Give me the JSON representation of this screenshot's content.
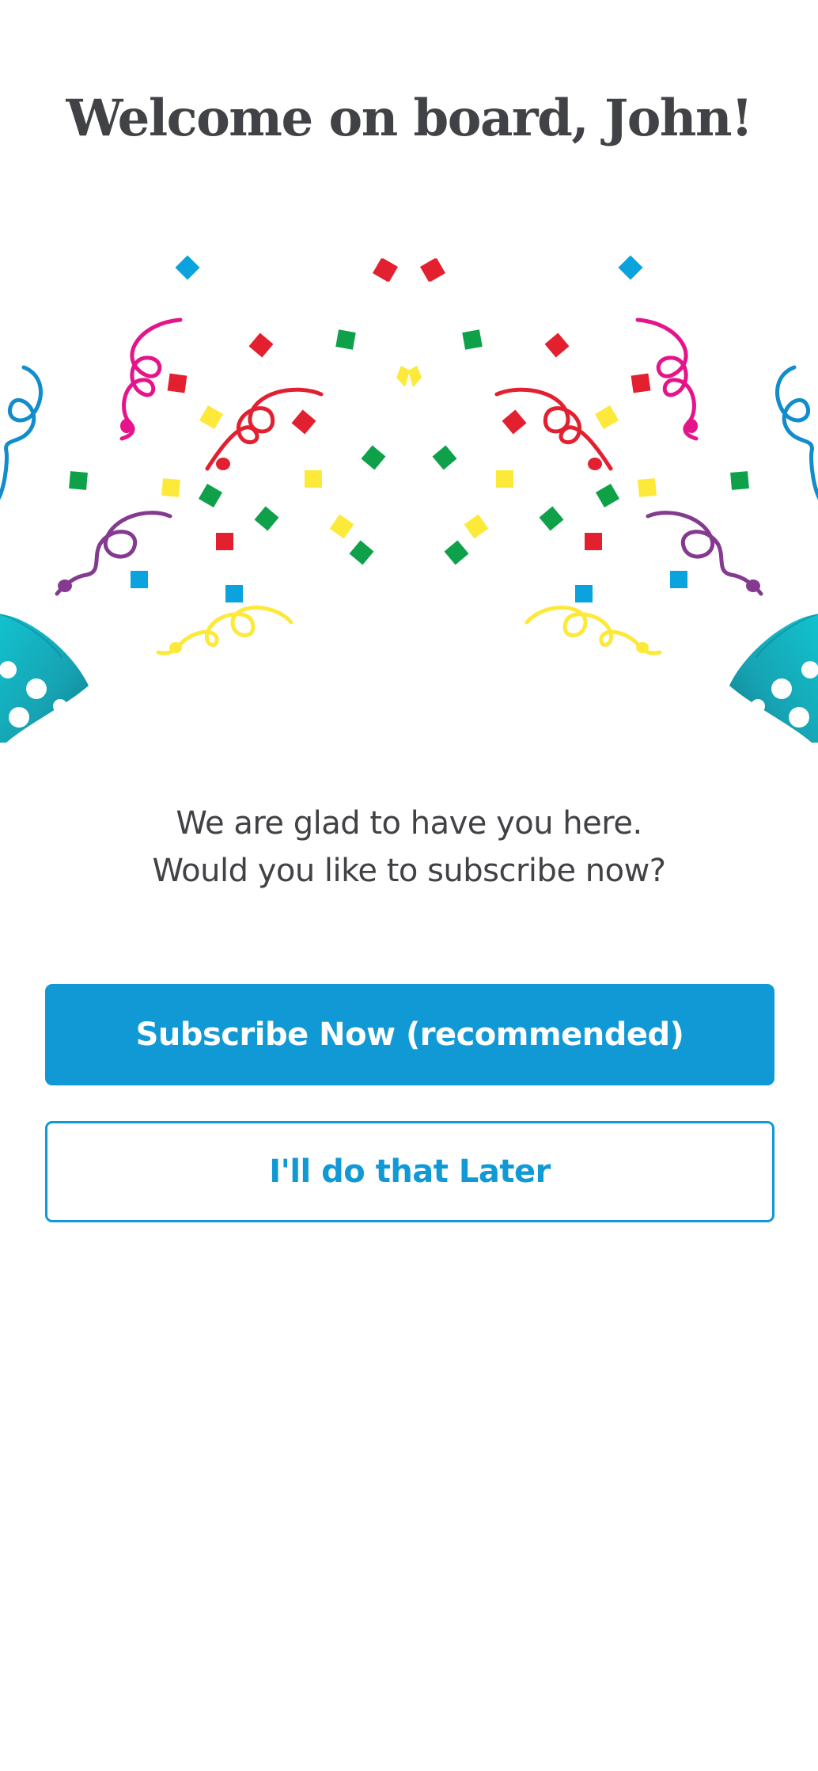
{
  "welcome": {
    "title": "Welcome on board, John!"
  },
  "illustration": {
    "icon": "confetti-party-popper-icon",
    "colors": {
      "red": "#e3202f",
      "green": "#0ea14a",
      "yellow": "#fde93a",
      "blue": "#0aa3dd",
      "pink": "#e5148b",
      "purple": "#833a8f",
      "teal": "#17a6b6",
      "streamer_blue": "#118ccd"
    }
  },
  "message": {
    "line1": "We are glad to have you here.",
    "line2": "Would you like to subscribe now?"
  },
  "actions": {
    "subscribe_label": "Subscribe Now (recommended)",
    "later_label": "I'll do that Later"
  },
  "theme": {
    "accent": "#1199d5",
    "text": "#414245",
    "background": "#ffffff"
  }
}
